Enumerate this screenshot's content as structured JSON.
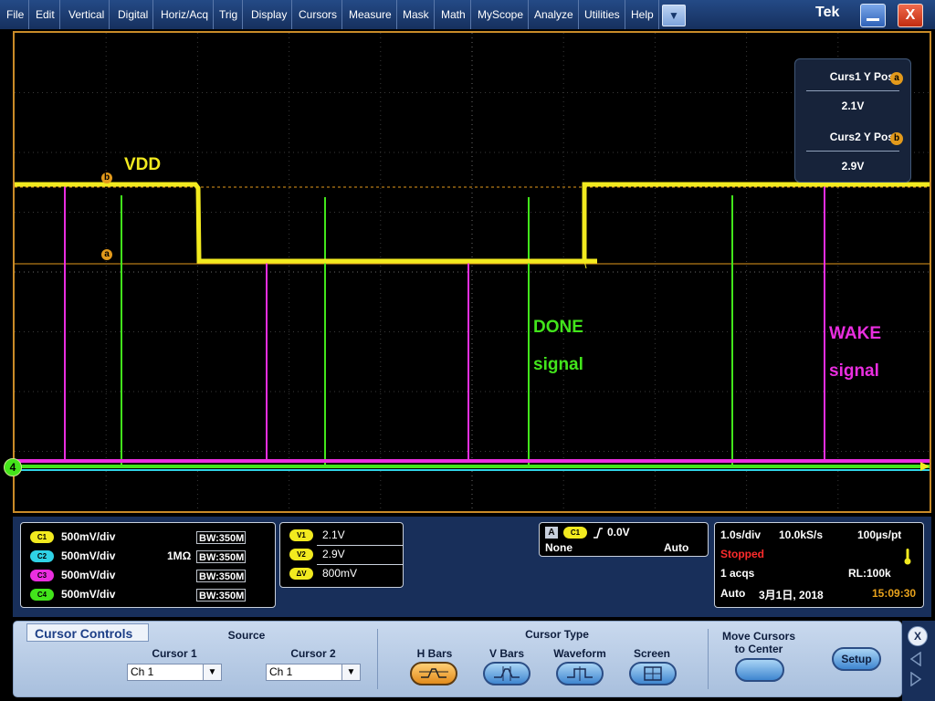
{
  "menubar": {
    "items": [
      "File",
      "Edit",
      "Vertical",
      "Digital",
      "Horiz/Acq",
      "Trig",
      "Display",
      "Cursors",
      "Measure",
      "Mask",
      "Math",
      "MyScope",
      "Analyze",
      "Utilities",
      "Help"
    ],
    "dropdown_icon": "chevron-down-icon",
    "brand": "Tek",
    "minimize_icon": "minimize-icon",
    "close_icon": "close-icon",
    "close_glyph": "X"
  },
  "display": {
    "colors": {
      "ch1": "#f2ea1f",
      "ch2": "#2fd2e6",
      "ch3": "#ea2ee0",
      "ch4": "#42e51b",
      "cursor": "#e39a1b",
      "border": "#c98b28"
    },
    "labels": {
      "vdd": "VDD",
      "done_line1": "DONE",
      "done_line2": "signal",
      "wake_line1": "WAKE",
      "wake_line2": "signal"
    },
    "cursor_markers": {
      "a": "a",
      "b": "b"
    },
    "ch4_marker": "4",
    "cursor_readout": {
      "curs1_title": "Curs1 Y Pos",
      "curs1_badge": "a",
      "curs1_value": "2.1V",
      "curs2_title": "Curs2 Y Pos",
      "curs2_badge": "b",
      "curs2_value": "2.9V"
    }
  },
  "channels": [
    {
      "badge": "C1",
      "scale": "500mV/div",
      "coupling": "",
      "bw": "350M"
    },
    {
      "badge": "C2",
      "scale": "500mV/div",
      "coupling": "1MΩ",
      "bw": "350M"
    },
    {
      "badge": "C3",
      "scale": "500mV/div",
      "coupling": "",
      "bw": "350M"
    },
    {
      "badge": "C4",
      "scale": "500mV/div",
      "coupling": "",
      "bw": "350M"
    }
  ],
  "bw_prefix": "BW:",
  "cursor_values": [
    {
      "badge": "V1",
      "value": "2.1V"
    },
    {
      "badge": "V2",
      "value": "2.9V"
    },
    {
      "badge": "ΔV",
      "value": "800mV"
    }
  ],
  "trigger": {
    "source_letter": "A",
    "channel": "C1",
    "slope_icon": "rising-edge-icon",
    "level": "0.0V",
    "coupling": "None",
    "mode": "Auto"
  },
  "acquisition": {
    "time_div": "1.0s/div",
    "sample_rate": "10.0kS/s",
    "resolution": "100µs/pt",
    "state": "Stopped",
    "acqs": "1 acqs",
    "record_length": "RL:100k",
    "mode": "Auto",
    "date": "3月1日, 2018",
    "time": "15:09:30",
    "status_icon": "thermometer-icon"
  },
  "cursor_controls": {
    "tab": "Cursor Controls",
    "source_label": "Source",
    "cursor1_label": "Cursor 1",
    "cursor1_value": "Ch 1",
    "cursor2_label": "Cursor 2",
    "cursor2_value": "Ch 1",
    "type_label": "Cursor Type",
    "types": [
      "H Bars",
      "V Bars",
      "Waveform",
      "Screen"
    ],
    "active_type": "H Bars",
    "move_line1": "Move Cursors",
    "move_line2": "to Center",
    "setup": "Setup",
    "close_glyph": "X"
  }
}
